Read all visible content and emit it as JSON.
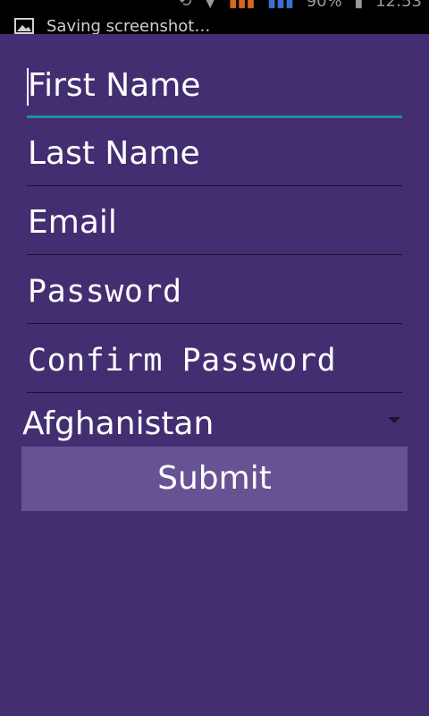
{
  "status_bar": {
    "notification_text": "Saving screenshot…",
    "notification_icon": "image-icon",
    "battery_text": "90%",
    "time": "12:53"
  },
  "form": {
    "first_name": {
      "placeholder": "First Name",
      "value": ""
    },
    "last_name": {
      "placeholder": "Last Name",
      "value": ""
    },
    "email": {
      "placeholder": "Email",
      "value": ""
    },
    "password": {
      "placeholder": "Password",
      "value": ""
    },
    "confirm_password": {
      "placeholder": "Confirm Password",
      "value": ""
    },
    "country": {
      "selected": "Afghanistan"
    },
    "submit_label": "Submit"
  },
  "colors": {
    "background": "#432e72",
    "button": "#675394",
    "focus_underline": "#1f8f9a"
  }
}
